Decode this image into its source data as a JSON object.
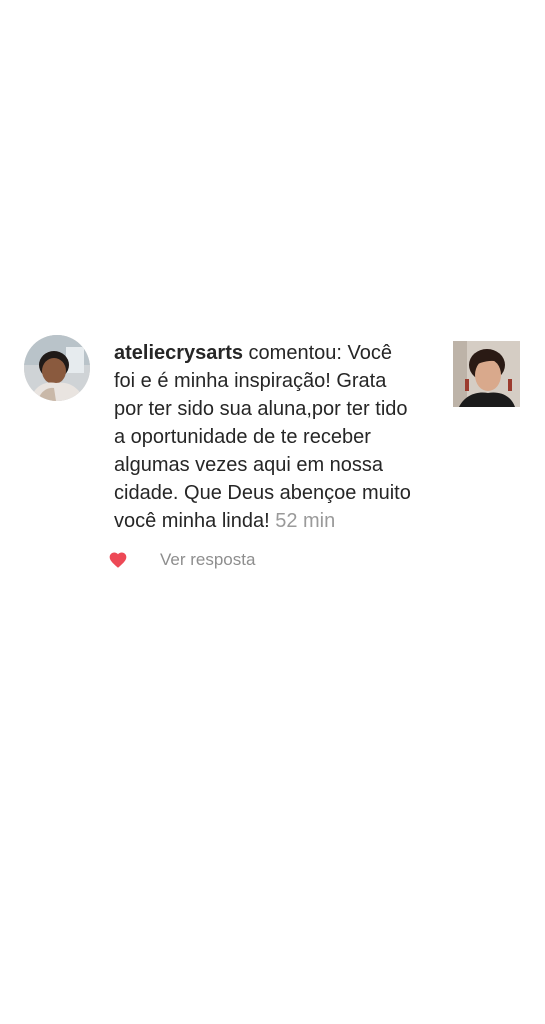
{
  "notification": {
    "username": "ateliecrysarts",
    "verb": " comentou: ",
    "comment": "Você foi e é minha inspiração! Grata por ter sido sua aluna,por ter tido a oportunidade de te receber algumas vezes aqui em nossa cidade. Que Deus abençoe muito você minha linda!",
    "time": "52 min",
    "avatar_icon": "user-avatar-photo",
    "thumbnail_icon": "post-thumbnail-photo"
  },
  "actions": {
    "like_icon": "heart-icon",
    "like_color": "#ed4956",
    "reply_label": "Ver resposta"
  }
}
